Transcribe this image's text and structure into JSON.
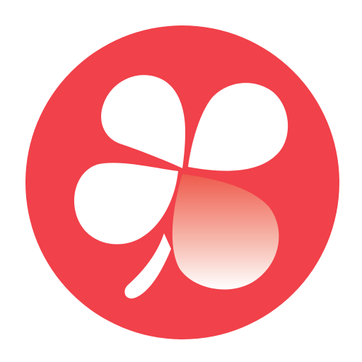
{
  "logo": {
    "icon_name": "four-leaf-clover-icon",
    "colors": {
      "background": "#ffffff",
      "circle": "#f1414a",
      "leaf": "#ffffff",
      "gradient_start": "#ee5a4c",
      "gradient_end": "#ffffff"
    }
  }
}
